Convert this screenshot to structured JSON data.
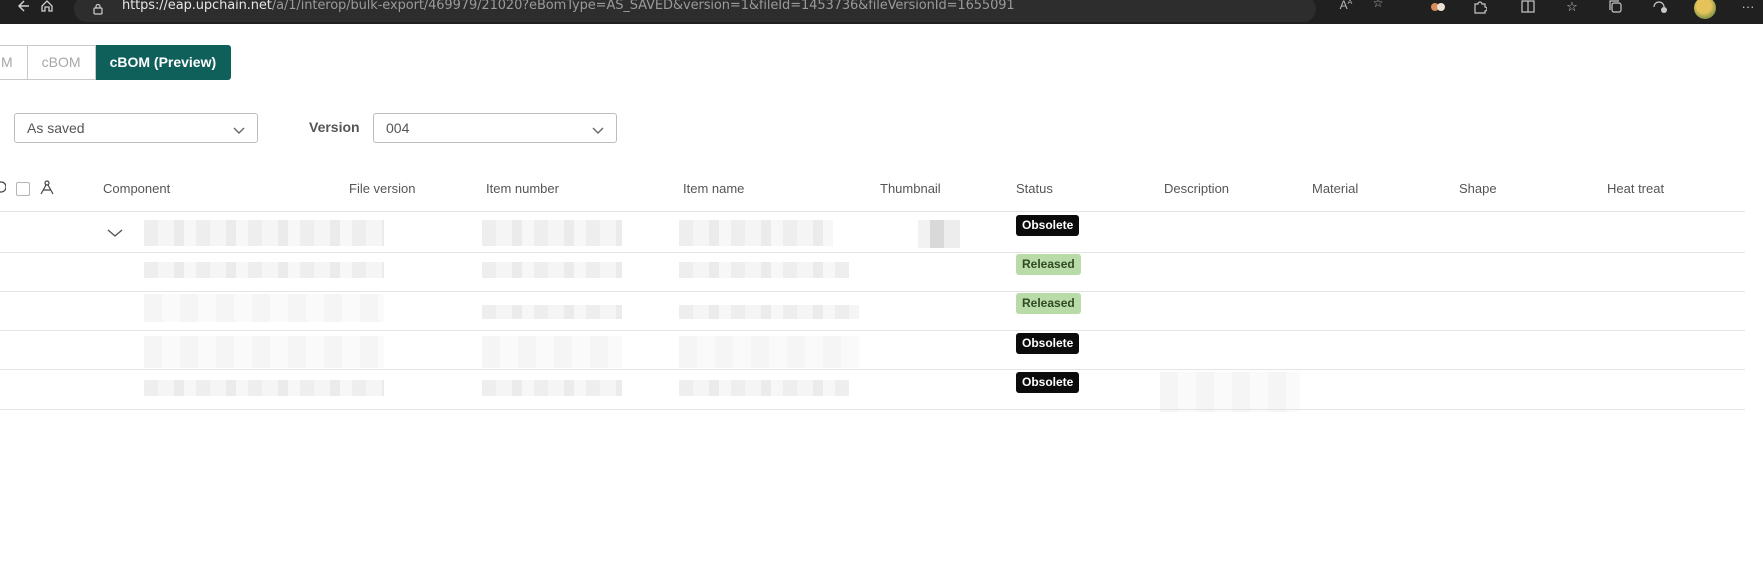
{
  "browser": {
    "url_host": "https://eap.upchain.net",
    "url_path": "/a/1/interop/bulk-export/469979/21020?eBomType=AS_SAVED&version=1&fileId=1453736&fileVersionId=1655091",
    "icons": [
      "back-icon",
      "home-icon",
      "lock-icon",
      "read-aloud-icon",
      "favorite-star-icon",
      "extension-icon",
      "puzzle-icon",
      "split-screen-icon",
      "favorites-list-icon",
      "collections-icon",
      "performance-icon",
      "profile-avatar",
      "more-icon"
    ]
  },
  "tabs": [
    {
      "label": "M",
      "active": false
    },
    {
      "label": "cBOM",
      "active": false
    },
    {
      "label": "cBOM (Preview)",
      "active": true
    }
  ],
  "filters": {
    "bom_type": {
      "value": "As saved"
    },
    "version": {
      "label": "Version",
      "value": "004"
    }
  },
  "table": {
    "headers": [
      "Component",
      "File version",
      "Item number",
      "Item name",
      "Thumbnail",
      "Status",
      "Description",
      "Material",
      "Shape",
      "Heat treat"
    ],
    "rows": [
      {
        "status": "Obsolete"
      },
      {
        "status": "Released"
      },
      {
        "status": "Released"
      },
      {
        "status": "Obsolete"
      },
      {
        "status": "Obsolete"
      }
    ]
  },
  "colors": {
    "active_tab": "#0f5f5a",
    "obsolete_badge": "#0b0b0b",
    "released_badge": "#b9dba8",
    "browser_bar": "#202020"
  }
}
